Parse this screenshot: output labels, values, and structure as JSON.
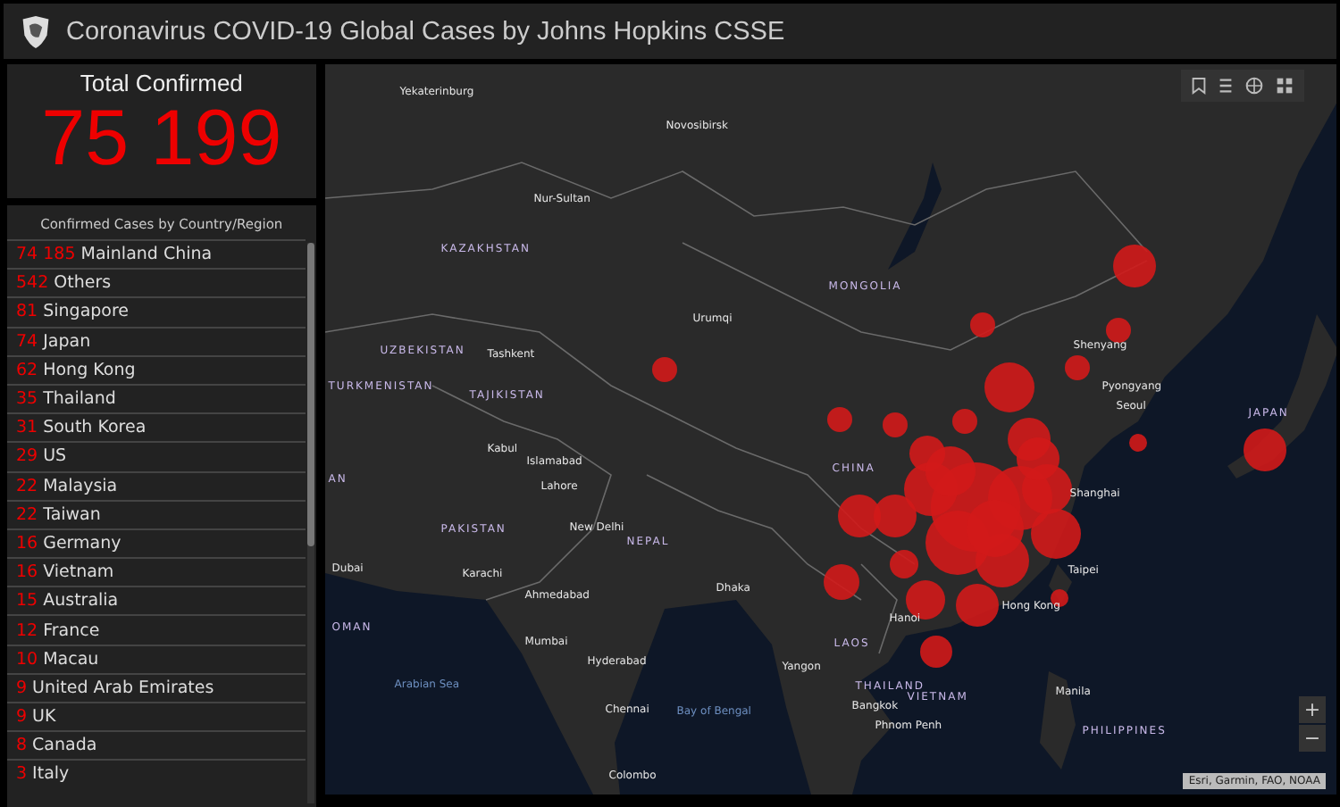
{
  "header": {
    "title": "Coronavirus COVID-19 Global Cases by Johns Hopkins CSSE"
  },
  "total": {
    "label": "Total Confirmed",
    "value": "75 199"
  },
  "country_list": {
    "title": "Confirmed Cases by Country/Region",
    "rows": [
      {
        "count": "74 185",
        "name": "Mainland China"
      },
      {
        "count": "542",
        "name": "Others"
      },
      {
        "count": "81",
        "name": "Singapore"
      },
      {
        "count": "74",
        "name": "Japan"
      },
      {
        "count": "62",
        "name": "Hong Kong"
      },
      {
        "count": "35",
        "name": "Thailand"
      },
      {
        "count": "31",
        "name": "South Korea"
      },
      {
        "count": "29",
        "name": "US"
      },
      {
        "count": "22",
        "name": "Malaysia"
      },
      {
        "count": "22",
        "name": "Taiwan"
      },
      {
        "count": "16",
        "name": "Germany"
      },
      {
        "count": "16",
        "name": "Vietnam"
      },
      {
        "count": "15",
        "name": "Australia"
      },
      {
        "count": "12",
        "name": "France"
      },
      {
        "count": "10",
        "name": "Macau"
      },
      {
        "count": "9",
        "name": "United Arab Emirates"
      },
      {
        "count": "9",
        "name": "UK"
      },
      {
        "count": "8",
        "name": "Canada"
      },
      {
        "count": "3",
        "name": "Italy"
      }
    ]
  },
  "map": {
    "labels": [
      {
        "text": "Yekaterinburg",
        "kind": "city"
      },
      {
        "text": "Novosibirsk",
        "kind": "city"
      },
      {
        "text": "Nur-Sultan",
        "kind": "city"
      },
      {
        "text": "KAZAKHSTAN",
        "kind": "country"
      },
      {
        "text": "MONGOLIA",
        "kind": "country"
      },
      {
        "text": "Urumqi",
        "kind": "city"
      },
      {
        "text": "UZBEKISTAN",
        "kind": "country"
      },
      {
        "text": "Tashkent",
        "kind": "city"
      },
      {
        "text": "TURKMENISTAN",
        "kind": "country"
      },
      {
        "text": "TAJIKISTAN",
        "kind": "country"
      },
      {
        "text": "Shenyang",
        "kind": "city"
      },
      {
        "text": "Pyongyang",
        "kind": "city"
      },
      {
        "text": "Seoul",
        "kind": "city"
      },
      {
        "text": "JAPAN",
        "kind": "country"
      },
      {
        "text": "Kabul",
        "kind": "city"
      },
      {
        "text": "Islamabad",
        "kind": "city"
      },
      {
        "text": "Lahore",
        "kind": "city"
      },
      {
        "text": "CHINA",
        "kind": "country"
      },
      {
        "text": "AN",
        "kind": "country"
      },
      {
        "text": "PAKISTAN",
        "kind": "country"
      },
      {
        "text": "New Delhi",
        "kind": "city"
      },
      {
        "text": "NEPAL",
        "kind": "country"
      },
      {
        "text": "Shanghai",
        "kind": "city"
      },
      {
        "text": "Dubai",
        "kind": "city"
      },
      {
        "text": "Karachi",
        "kind": "city"
      },
      {
        "text": "Taipei",
        "kind": "city"
      },
      {
        "text": "Ahmedabad",
        "kind": "city"
      },
      {
        "text": "Dhaka",
        "kind": "city"
      },
      {
        "text": "Hong Kong",
        "kind": "city"
      },
      {
        "text": "Hanoi",
        "kind": "city"
      },
      {
        "text": "OMAN",
        "kind": "country"
      },
      {
        "text": "Mumbai",
        "kind": "city"
      },
      {
        "text": "Hyderabad",
        "kind": "city"
      },
      {
        "text": "Yangon",
        "kind": "city"
      },
      {
        "text": "LAOS",
        "kind": "country"
      },
      {
        "text": "THAILAND",
        "kind": "country"
      },
      {
        "text": "VIETNAM",
        "kind": "country"
      },
      {
        "text": "Bangkok",
        "kind": "city"
      },
      {
        "text": "Arabian Sea",
        "kind": "water"
      },
      {
        "text": "Manila",
        "kind": "city"
      },
      {
        "text": "Chennai",
        "kind": "city"
      },
      {
        "text": "Bay of Bengal",
        "kind": "water"
      },
      {
        "text": "Phnom Penh",
        "kind": "city"
      },
      {
        "text": "PHILIPPINES",
        "kind": "country"
      },
      {
        "text": "Colombo",
        "kind": "city"
      }
    ],
    "zoom_controls": [
      "+",
      "−"
    ],
    "attribution": "Esri, Garmin, FAO, NOAA"
  }
}
